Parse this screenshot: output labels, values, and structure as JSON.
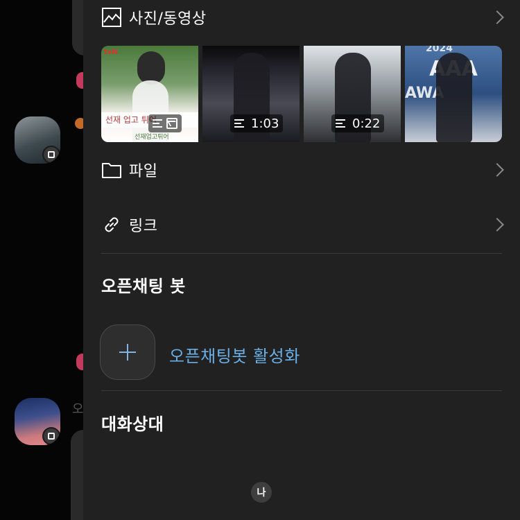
{
  "drawer": {
    "photos": {
      "label": "사진/동영상"
    },
    "thumbnails": [
      {
        "kind": "image",
        "banner": "선재 업고 튀어",
        "sub": "선재업고튀어",
        "logo": "tvN"
      },
      {
        "kind": "video",
        "duration": "1:03"
      },
      {
        "kind": "video",
        "duration": "0:22"
      },
      {
        "kind": "image",
        "big_text_1": "AAA",
        "big_text_2": "AWA",
        "top_text": "2024"
      }
    ],
    "files": {
      "label": "파일"
    },
    "links": {
      "label": "링크"
    },
    "openchat_bot": {
      "title": "오픈채팅 봇",
      "activate_label": "오픈채팅봇 활성화"
    },
    "partner": {
      "title": "대화상대",
      "me_badge": "나"
    }
  },
  "background": {
    "partial_text": "오"
  }
}
